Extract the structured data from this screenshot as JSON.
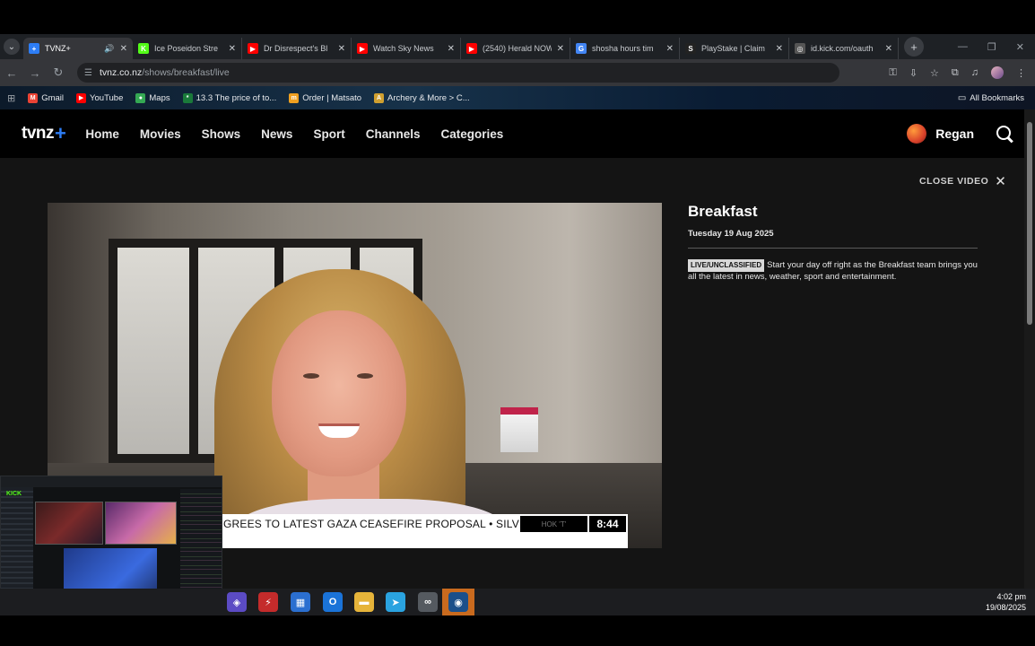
{
  "browser": {
    "tabs": [
      {
        "title": "TVNZ+",
        "favicon": "tvnz-plus-icon",
        "color": "#2d7df5",
        "glyph": "+",
        "active": true,
        "audio": true
      },
      {
        "title": "Ice Poseidon Stre",
        "favicon": "kick-icon",
        "color": "#53fc18",
        "glyph": "K",
        "active": false
      },
      {
        "title": "Dr Disrespect's Bl",
        "favicon": "youtube-icon",
        "color": "#ff0000",
        "glyph": "▶",
        "active": false
      },
      {
        "title": "Watch Sky News",
        "favicon": "youtube-icon",
        "color": "#ff0000",
        "glyph": "▶",
        "active": false
      },
      {
        "title": "(2540) Herald NOW",
        "favicon": "youtube-icon",
        "color": "#ff0000",
        "glyph": "▶",
        "active": false
      },
      {
        "title": "shosha hours tim",
        "favicon": "google-icon",
        "color": "#4285f4",
        "glyph": "G",
        "active": false
      },
      {
        "title": "PlayStake | Claim",
        "favicon": "playstake-icon",
        "color": "#222222",
        "glyph": "S",
        "active": false
      },
      {
        "title": "id.kick.com/oauth",
        "favicon": "globe-icon",
        "color": "#555555",
        "glyph": "◎",
        "active": false
      }
    ],
    "new_tab": "+",
    "url_domain": "tvnz.co.nz",
    "url_path": "/shows/breakfast/live",
    "bookmarks": [
      {
        "label": "Gmail",
        "icon": "gmail-icon",
        "color": "#ea4335",
        "glyph": "M"
      },
      {
        "label": "YouTube",
        "icon": "youtube-icon",
        "color": "#ff0000",
        "glyph": "▶"
      },
      {
        "label": "Maps",
        "icon": "maps-icon",
        "color": "#34a853",
        "glyph": "●"
      },
      {
        "label": "13.3 The price of to...",
        "icon": "bookmark-icon",
        "color": "#1a7a3a",
        "glyph": "*"
      },
      {
        "label": "Order | Matsato",
        "icon": "matsato-icon",
        "color": "#f0a020",
        "glyph": "m"
      },
      {
        "label": "Archery & More > C...",
        "icon": "archery-icon",
        "color": "#d0a030",
        "glyph": "A"
      }
    ],
    "all_bookmarks": "All Bookmarks"
  },
  "site": {
    "logo_text": "tvnz",
    "logo_plus": "+",
    "nav": [
      "Home",
      "Movies",
      "Shows",
      "News",
      "Sport",
      "Channels",
      "Categories"
    ],
    "user": "Regan",
    "close_video": "CLOSE VIDEO",
    "close_icon": "✕"
  },
  "show": {
    "title": "Breakfast",
    "date": "Tuesday 19 Aug 2025",
    "badge": "LIVE/UNCLASSIFIED",
    "description": "Start your day off right as the Breakfast team brings you all the latest in news, weather, sport and entertainment."
  },
  "ticker": {
    "text": "GREES TO LATEST GAZA CEASEFIRE PROPOSAL  •  SILVER F",
    "badge": "HOK 'T'",
    "time": "8:44"
  },
  "stream_overlay": {
    "brand": "KICK"
  },
  "taskbar": {
    "apps": [
      {
        "name": "app-purple-icon",
        "color": "#5b4bc4",
        "glyph": "◈"
      },
      {
        "name": "app-red-icon",
        "color": "#c42b2b",
        "glyph": "⚡"
      },
      {
        "name": "store-icon",
        "color": "#2b6fd0",
        "glyph": "▦"
      },
      {
        "name": "outlook-icon",
        "color": "#1a73d8",
        "glyph": "O"
      },
      {
        "name": "file-explorer-icon",
        "color": "#e6b43a",
        "glyph": "▬"
      },
      {
        "name": "telegram-icon",
        "color": "#2aa3e0",
        "glyph": "➤"
      },
      {
        "name": "app-link-icon",
        "color": "#555a60",
        "glyph": "∞"
      },
      {
        "name": "steam-icon",
        "color": "#1b4f8a",
        "glyph": "◉"
      }
    ],
    "time": "4:02 pm",
    "date": "19/08/2025"
  }
}
